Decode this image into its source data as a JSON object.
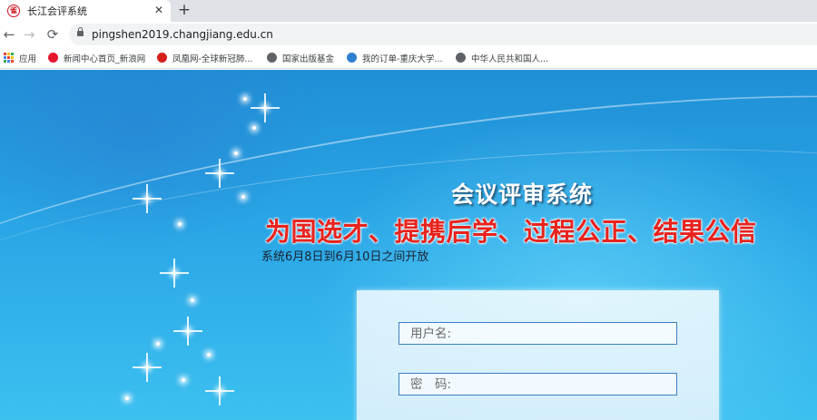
{
  "browser": {
    "tab": {
      "title": "长江会评系统",
      "favicon_glyph": "雀",
      "favicon_color": "#c8161d"
    },
    "close_glyph": "✕",
    "new_tab_glyph": "+",
    "nav": {
      "back_glyph": "←",
      "forward_glyph": "→",
      "reload_glyph": "⟳"
    },
    "url": "pingshen2019.changjiang.edu.cn",
    "bookmarks": [
      {
        "label": "应用",
        "icon": "apps-icon"
      },
      {
        "label": "新闻中心首页_新浪网",
        "icon": "sina-icon",
        "color": "#e6162d"
      },
      {
        "label": "凤凰网-全球新冠肺...",
        "icon": "ifeng-icon",
        "color": "#d6201c"
      },
      {
        "label": "国家出版基金",
        "icon": "globe-icon",
        "color": "#5f6368"
      },
      {
        "label": "我的订单-重庆大学...",
        "icon": "globe-icon",
        "color": "#2f7fd3"
      },
      {
        "label": "中华人民共和国人...",
        "icon": "globe-icon",
        "color": "#5f6368"
      }
    ]
  },
  "page": {
    "title": "会议评审系统",
    "slogan": "为国选才、提携后学、过程公正、结果公信",
    "notice": "系统6月8日到6月10日之间开放",
    "login": {
      "username_placeholder": "用户名:",
      "password_placeholder": "密　码:"
    }
  },
  "colors": {
    "accent_blue": "#3d7fc1",
    "slogan_red": "#e8231d"
  }
}
